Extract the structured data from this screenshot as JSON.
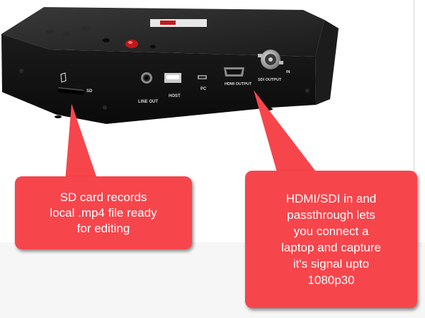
{
  "device": {
    "port_labels": {
      "sd": "SD",
      "line_out": "LINE OUT",
      "host": "HOST",
      "pc": "PC",
      "hdmi_output": "HDMI OUTPUT",
      "sdi_output": "SDI OUTPUT",
      "in": "IN"
    }
  },
  "callouts": {
    "sd_card": "SD card records\nlocal .mp4 file ready\nfor editing",
    "hdmi_sdi": "HDMI/SDI in and\npassthrough lets\nyou connect a\nlaptop and capture\nit's signal upto\n1080p30"
  },
  "colors": {
    "callout": "#f7454c",
    "device_body": "#161616"
  }
}
